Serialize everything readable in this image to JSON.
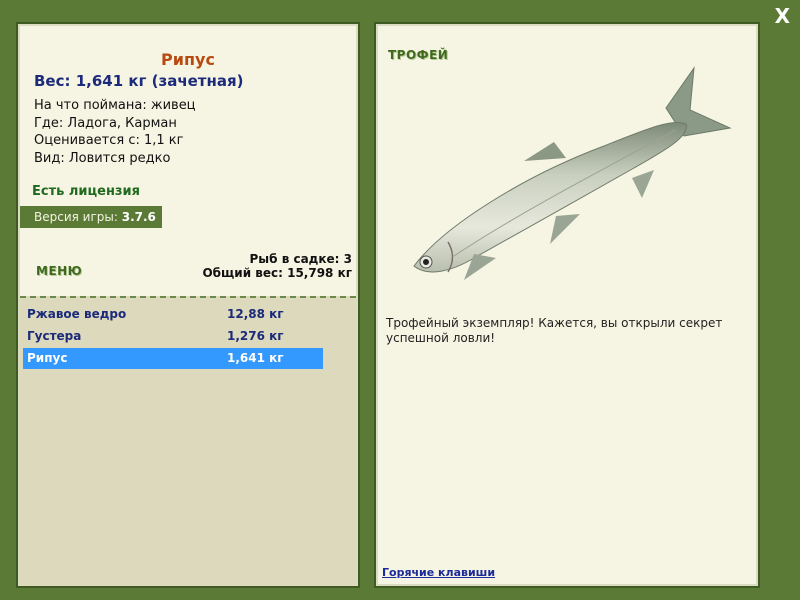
{
  "close_label": "X",
  "fish": {
    "title": "Рипус",
    "weight_line": "Вес: 1,641 кг (зачетная)",
    "bait_line": "На что поймана: живец",
    "where_line": "Где: Ладога, Карман",
    "rated_line": "Оценивается с: 1,1 кг",
    "kind_line": "Вид: Ловится редко"
  },
  "license": "Есть лицензия",
  "version": {
    "label": "Версия игры:",
    "value": "3.7.6"
  },
  "menu_label": "МЕНЮ",
  "keepnet": {
    "count_line": "Рыб в садке: 3",
    "total_line": "Общий вес: 15,798 кг"
  },
  "catch_list": [
    {
      "name": "Ржавое ведро",
      "weight": "12,88 кг"
    },
    {
      "name": "Густера",
      "weight": "1,276 кг"
    },
    {
      "name": "Рипус",
      "weight": "1,641 кг"
    }
  ],
  "trophy": {
    "header": "ТРОФЕЙ",
    "text": "Трофейный экземпляр! Кажется, вы открыли секрет успешной ловли!"
  },
  "hotkeys_label": "Горячие клавиши",
  "colors": {
    "frame_green": "#5b7a36",
    "panel_bg": "#f6f4e2",
    "selection_blue": "#3399ff",
    "title_orange": "#b84a10",
    "text_navy": "#1b2a7a"
  }
}
